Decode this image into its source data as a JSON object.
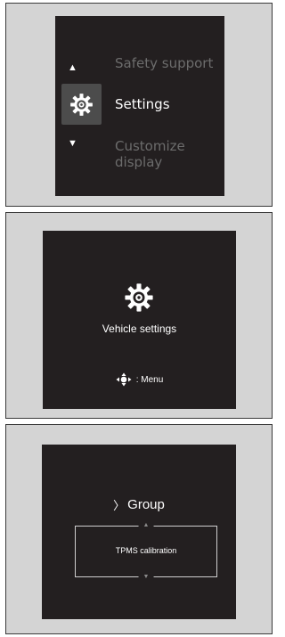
{
  "panel1": {
    "up_arrow": "▲",
    "down_arrow": "▼",
    "items": [
      {
        "label": "Safety support",
        "state": "dimmed"
      },
      {
        "label": "Settings",
        "state": "selected",
        "icon": "gear-icon"
      },
      {
        "label": "Customize display",
        "state": "dimmed"
      }
    ]
  },
  "panel2": {
    "icon": "gear-icon",
    "title": "Vehicle settings",
    "hint_icon": "dpad-icon",
    "hint_text": ": Menu"
  },
  "panel3": {
    "chevron": "〉",
    "group_label": "Group",
    "up_arrow": "▲",
    "down_arrow": "▼",
    "selected_item": "TPMS calibration"
  },
  "colors": {
    "screen_bg": "#231f20",
    "panel_bg": "#d4d4d4",
    "dimmed_text": "#6c6c6c",
    "selected_bg": "#4c4c4c"
  }
}
